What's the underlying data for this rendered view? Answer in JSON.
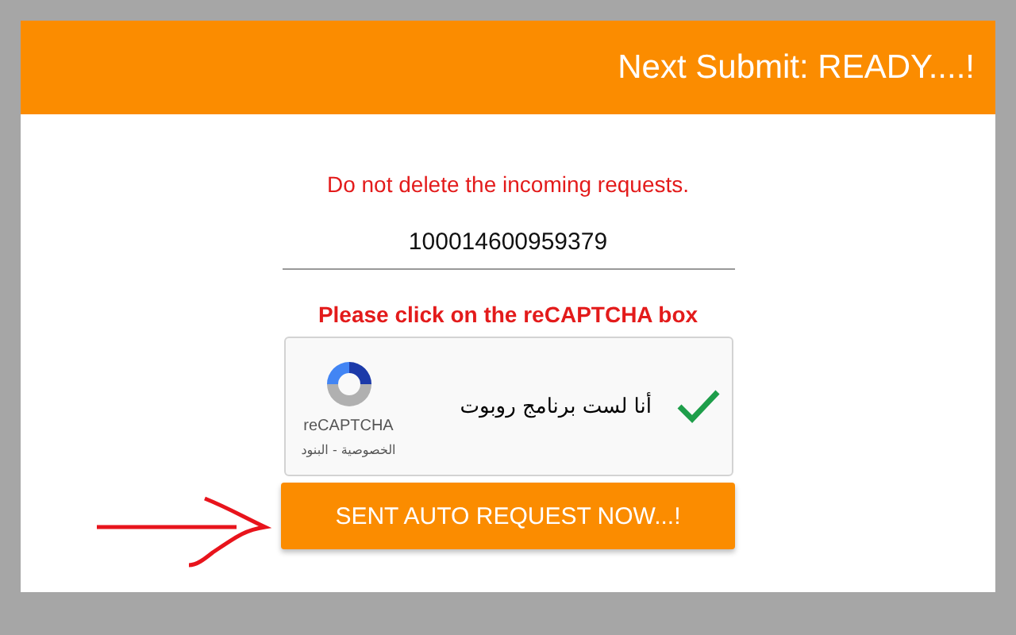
{
  "header": {
    "title": "Next Submit: READY....!"
  },
  "warning": "Do not delete the incoming requests.",
  "id_field": {
    "value": "100014600959379"
  },
  "instruction": "Please click on the reCAPTCHA box",
  "captcha": {
    "label": "أنا لست برنامج روبوت",
    "checked": true,
    "brand": "reCAPTCHA",
    "links": "الخصوصية - البنود"
  },
  "submit_button": "SENT AUTO REQUEST NOW...!"
}
